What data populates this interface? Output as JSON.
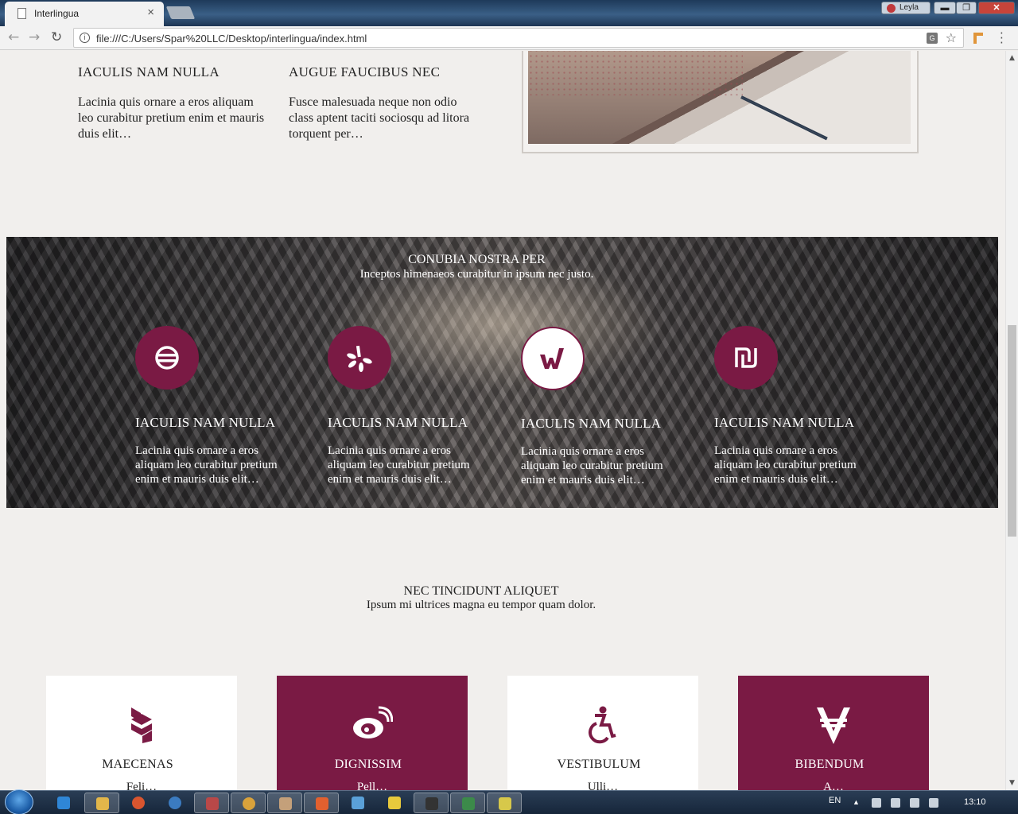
{
  "browser": {
    "tab_title": "Interlingua",
    "tab_close": "×",
    "user_name": "Leyla",
    "url": "file:///C:/Users/Spar%20LLC/Desktop/interlingua/index.html",
    "nav_back": "←",
    "nav_forward": "→",
    "nav_reload": "↻",
    "star": "☆",
    "window_min": "▬",
    "window_max": "❐",
    "window_close": "✕"
  },
  "top_features": [
    {
      "title": "IACULIS NAM NULLA",
      "text": "Lacinia quis ornare a eros aliquam leo curabitur pretium enim et mauris duis elit…"
    },
    {
      "title": "AUGUE FAUCIBUS NEC",
      "text": "Fusce malesuada neque non odio class aptent taciti sociosqu ad litora torquent per…"
    }
  ],
  "band": {
    "title": "CONUBIA NOSTRA PER",
    "subtitle": "Inceptos himenaeos curabitur in ipsum nec justo.",
    "services": [
      {
        "icon": "ring-icon",
        "title": "IACULIS NAM NULLA",
        "text": "Lacinia quis ornare a eros aliquam leo curabitur pretium enim et mauris duis elit…"
      },
      {
        "icon": "yelp-icon",
        "title": "IACULIS NAM NULLA",
        "text": "Lacinia quis ornare a eros aliquam leo curabitur pretium enim et mauris duis elit…"
      },
      {
        "icon": "w-logo-icon",
        "title": "IACULIS NAM NULLA",
        "text": "Lacinia quis ornare a eros aliquam leo curabitur pretium enim et mauris duis elit…"
      },
      {
        "icon": "shekel-icon",
        "title": "IACULIS NAM NULLA",
        "text": "Lacinia quis ornare a eros aliquam leo curabitur pretium enim et mauris duis elit…"
      }
    ]
  },
  "section": {
    "title": "NEC TINCIDUNT ALIQUET",
    "subtitle": "Ipsum mi ultrices magna eu tempor quam dolor."
  },
  "cards": [
    {
      "icon": "hubspot-hex-icon",
      "title": "MAECENAS",
      "clip": "Feli…"
    },
    {
      "icon": "weibo-icon",
      "title": "DIGNISSIM",
      "clip": "Pell…"
    },
    {
      "icon": "wheelchair-icon",
      "title": "VESTIBULUM",
      "clip": "Ulli…"
    },
    {
      "icon": "viacoin-icon",
      "title": "BIBENDUM",
      "clip": "A…"
    }
  ],
  "taskbar": {
    "language": "EN",
    "clock": "13:10"
  },
  "colors": {
    "accent": "#7a1a44",
    "page_bg": "#f1efed"
  }
}
